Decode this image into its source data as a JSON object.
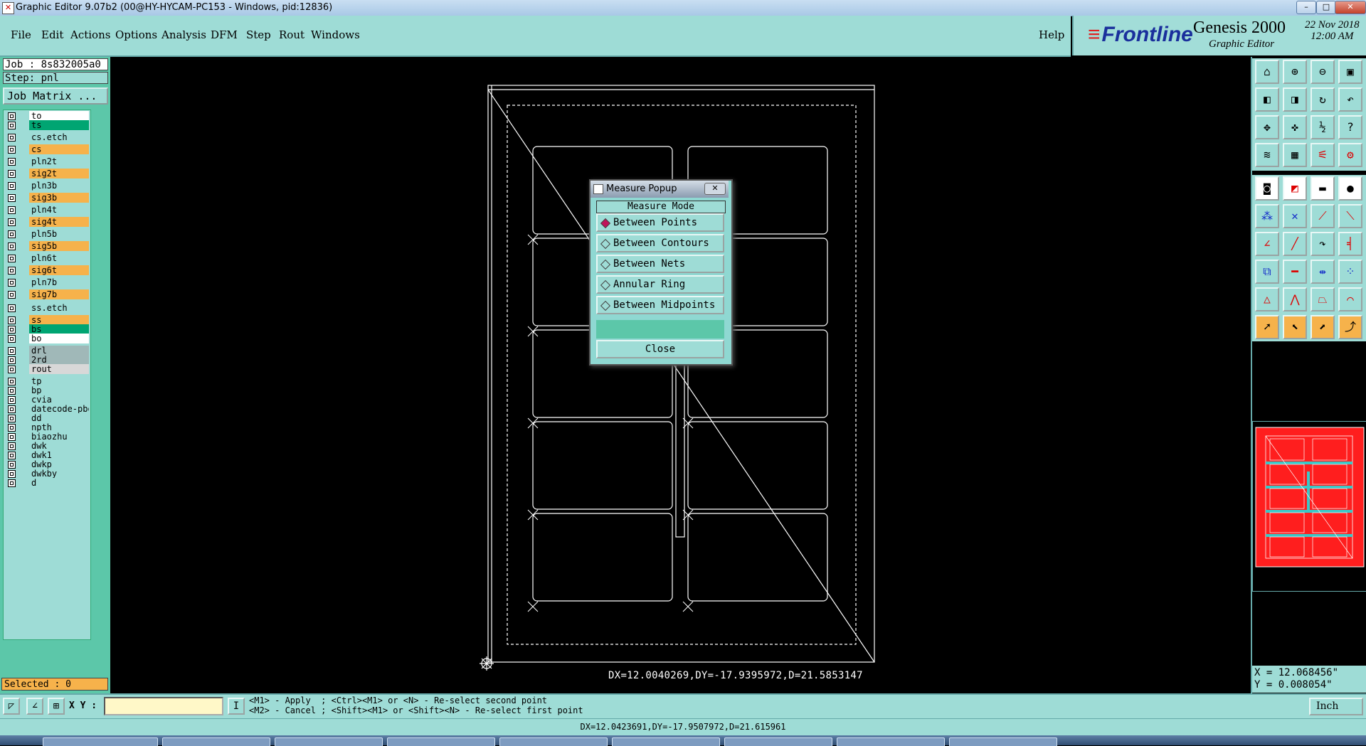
{
  "window": {
    "title": "Graphic Editor 9.07b2 (00@HY-HYCAM-PC153 - Windows, pid:12836)"
  },
  "menu": [
    "File",
    "Edit",
    "Actions",
    "Options",
    "Analysis",
    "DFM",
    "Step",
    "Rout",
    "Windows"
  ],
  "help_label": "Help",
  "brand": {
    "vendor": "Frontline",
    "product": "Genesis 2000",
    "subtitle": "Graphic Editor",
    "date": "22 Nov 2018",
    "time": "12:00 AM"
  },
  "job": {
    "job_line": "Job : 8s832005a0",
    "step_line": "Step: pnl",
    "job_matrix_label": "Job Matrix ..."
  },
  "layers": [
    {
      "name": "to",
      "color": "#ffffff"
    },
    {
      "name": "ts",
      "color": "#00a572"
    },
    {
      "name": "cs.etch",
      "color": "#9edcd6"
    },
    {
      "name": "cs",
      "color": "#f6b24b"
    },
    {
      "name": "pln2t",
      "color": "#9edcd6"
    },
    {
      "name": "sig2t",
      "color": "#f6b24b"
    },
    {
      "name": "pln3b",
      "color": "#9edcd6"
    },
    {
      "name": "sig3b",
      "color": "#f6b24b"
    },
    {
      "name": "pln4t",
      "color": "#9edcd6"
    },
    {
      "name": "sig4t",
      "color": "#f6b24b"
    },
    {
      "name": "pln5b",
      "color": "#9edcd6"
    },
    {
      "name": "sig5b",
      "color": "#f6b24b"
    },
    {
      "name": "pln6t",
      "color": "#9edcd6"
    },
    {
      "name": "sig6t",
      "color": "#f6b24b"
    },
    {
      "name": "pln7b",
      "color": "#9edcd6"
    },
    {
      "name": "sig7b",
      "color": "#f6b24b"
    },
    {
      "name": "ss.etch",
      "color": "#9edcd6"
    },
    {
      "name": "ss",
      "color": "#f6b24b"
    },
    {
      "name": "bs",
      "color": "#00a572"
    },
    {
      "name": "bo",
      "color": "#ffffff"
    },
    {
      "name": "drl",
      "color": "#a0b8b8"
    },
    {
      "name": "2rd",
      "color": "#a0b8b8"
    },
    {
      "name": "rout",
      "color": "#d8d8d8"
    },
    {
      "name": "tp",
      "color": "#9edcd6"
    },
    {
      "name": "bp",
      "color": "#9edcd6"
    },
    {
      "name": "cvia",
      "color": "#9edcd6"
    },
    {
      "name": "datecode-pbo",
      "color": "#9edcd6"
    },
    {
      "name": "dd",
      "color": "#9edcd6"
    },
    {
      "name": "npth",
      "color": "#9edcd6"
    },
    {
      "name": "biaozhu",
      "color": "#9edcd6"
    },
    {
      "name": "dwk",
      "color": "#9edcd6"
    },
    {
      "name": "dwk1",
      "color": "#9edcd6"
    },
    {
      "name": "dwkp",
      "color": "#9edcd6"
    },
    {
      "name": "dwkby",
      "color": "#9edcd6"
    },
    {
      "name": "d",
      "color": "#9edcd6"
    }
  ],
  "selected_label": "Selected : 0",
  "measure_popup": {
    "title": "Measure Popup",
    "close_x": "✕",
    "mode_label": "Measure Mode",
    "options": [
      {
        "label": "Between Points",
        "selected": true
      },
      {
        "label": "Between Contours",
        "selected": false
      },
      {
        "label": "Between Nets",
        "selected": false
      },
      {
        "label": "Annular Ring",
        "selected": false
      },
      {
        "label": "Between Midpoints",
        "selected": false
      }
    ],
    "close_label": "Close"
  },
  "canvas_measure": "DX=12.0040269,DY=-17.9395972,D=21.5853147",
  "coords": {
    "x": "X = 12.068456\"",
    "y": "Y = 0.008054\""
  },
  "bottom": {
    "xy_label": "X Y :",
    "hint_line1": "<M1> - Apply  ; <Ctrl><M1> or <N> - Re-select second point",
    "hint_line2": "<M2> - Cancel ; <Shift><M1> or <Shift><N> - Re-select first point",
    "unit": "Inch"
  },
  "status_line": "DX=12.0423691,DY=-17.9507972,D=21.615961"
}
